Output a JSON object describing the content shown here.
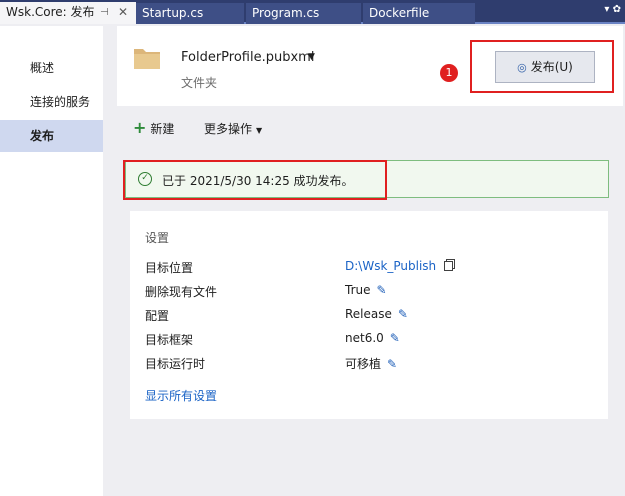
{
  "tabs": [
    {
      "label": "Wsk.Core: 发布",
      "active": true
    },
    {
      "label": "Startup.cs"
    },
    {
      "label": "Program.cs"
    },
    {
      "label": "Dockerfile"
    }
  ],
  "tab_pin": "⊣",
  "tab_close": "✕",
  "tabbar_icons": "▾ ✿",
  "nav": {
    "items": [
      {
        "label": "概述"
      },
      {
        "label": "连接的服务"
      },
      {
        "label": "发布"
      }
    ]
  },
  "profile": {
    "name": "FolderProfile.pubxml",
    "subtitle": "文件夹"
  },
  "badge": "1",
  "publish_button": "发布(U)",
  "toolbar": {
    "new_label": "新建",
    "more_label": "更多操作"
  },
  "success_message": "已于 2021/5/30 14:25 成功发布。",
  "settings": {
    "title": "设置",
    "rows": [
      {
        "label": "目标位置",
        "value": "D:\\Wsk_Publish"
      },
      {
        "label": "删除现有文件",
        "value": "True"
      },
      {
        "label": "配置",
        "value": "Release"
      },
      {
        "label": "目标框架",
        "value": "net6.0"
      },
      {
        "label": "目标运行时",
        "value": "可移植"
      }
    ],
    "show_all": "显示所有设置"
  },
  "colors": {
    "accent": "#1a63c6",
    "highlight_box": "#e02020",
    "success_border": "#7ebd7f",
    "tab_bar": "#2f3d6e"
  }
}
